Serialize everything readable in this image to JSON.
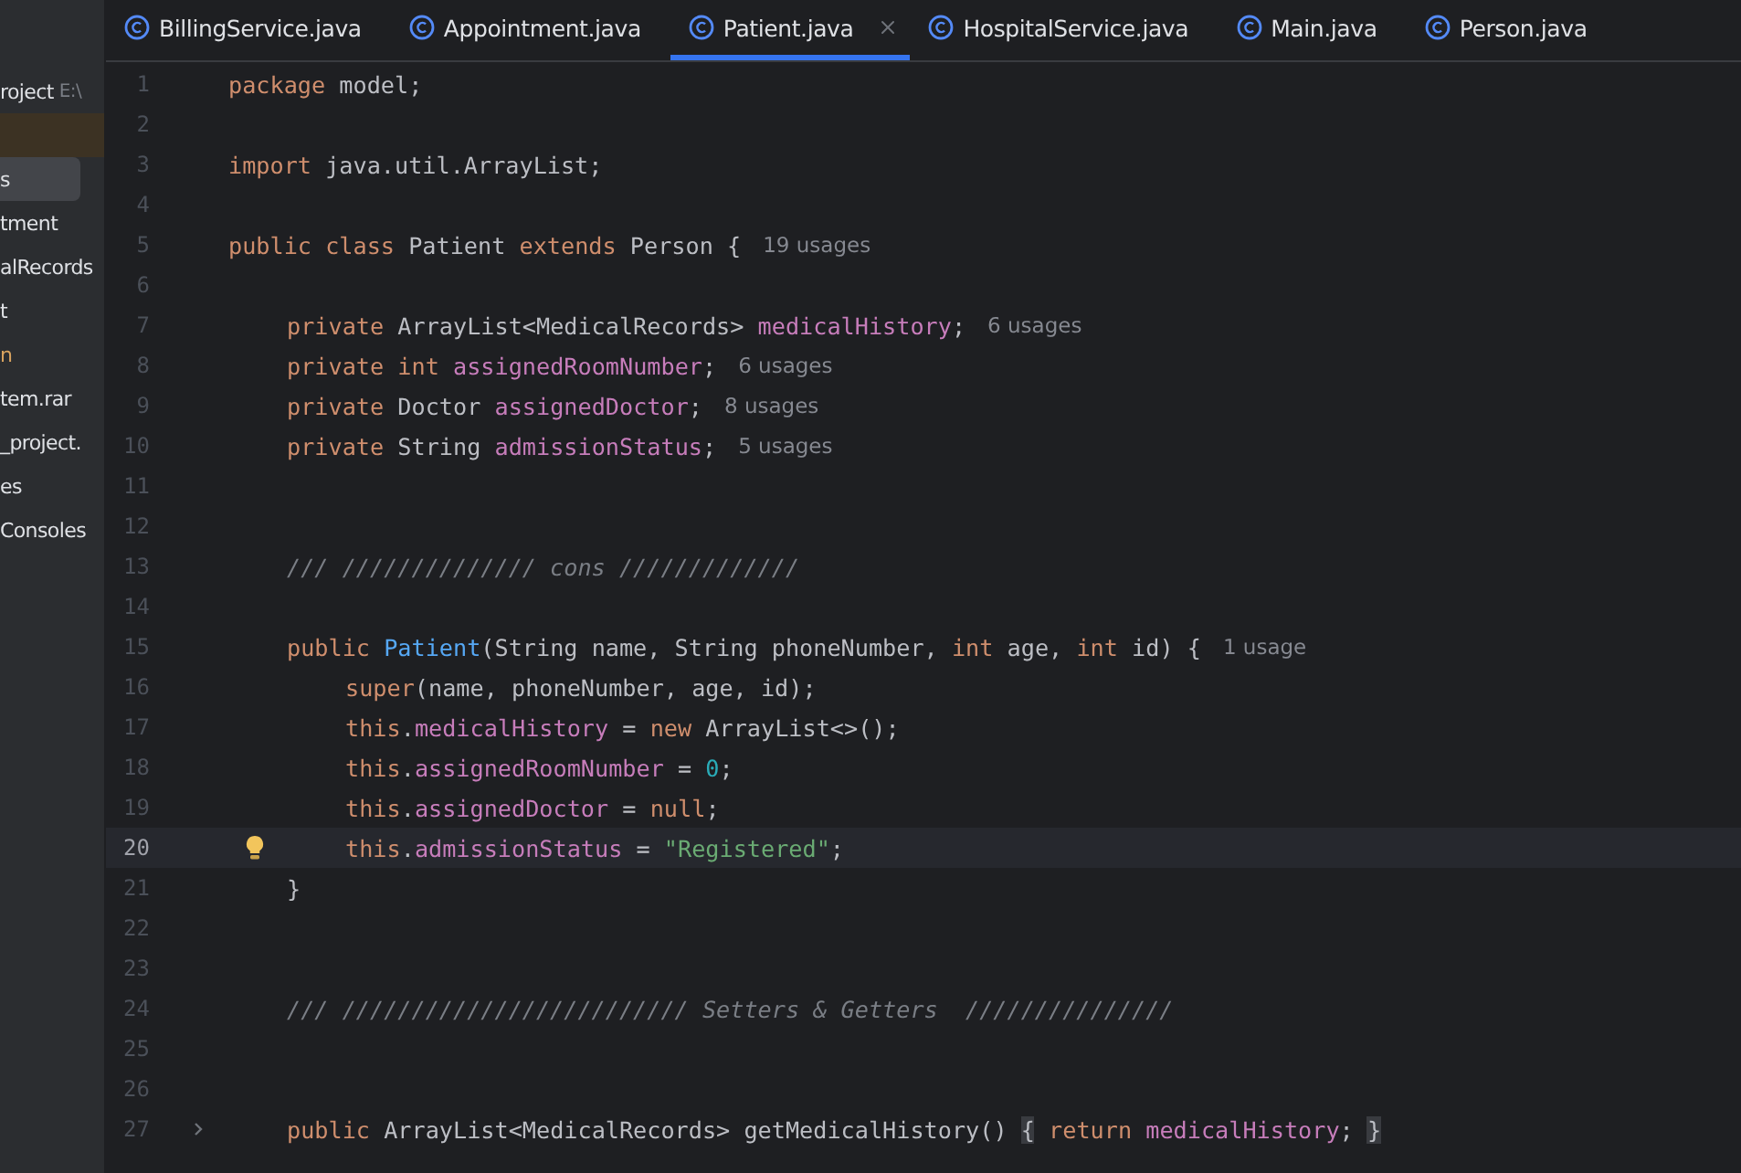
{
  "tabs": [
    {
      "label": "BillingService.java",
      "selected": false
    },
    {
      "label": "Appointment.java",
      "selected": false
    },
    {
      "label": "Patient.java",
      "selected": true
    },
    {
      "label": "HospitalService.java",
      "selected": false
    },
    {
      "label": "Main.java",
      "selected": false
    },
    {
      "label": "Person.java",
      "selected": false
    }
  ],
  "sidebar": {
    "items": [
      {
        "label": "roject",
        "path": "E:\\",
        "selected": false,
        "highlighted": false
      },
      {
        "selected": false,
        "highlighted": true
      },
      {
        "label": "s",
        "selected": true,
        "highlighted": false
      },
      {
        "label": "tment",
        "selected": false,
        "highlighted": false
      },
      {
        "label": "alRecords",
        "selected": false,
        "highlighted": false
      },
      {
        "label": "t",
        "selected": false,
        "highlighted": false
      },
      {
        "label": "n",
        "selected": false,
        "highlighted": false,
        "color": "#d9a35f"
      },
      {
        "label": "tem.rar",
        "selected": false,
        "highlighted": false
      },
      {
        "label": "_project.",
        "selected": false,
        "highlighted": false
      },
      {
        "label": "es",
        "selected": false,
        "highlighted": false
      },
      {
        "label": "Consoles",
        "selected": false,
        "highlighted": false
      }
    ]
  },
  "editor": {
    "lines": [
      {
        "number": "1",
        "tokens": [
          {
            "kind": "kw",
            "text": "package"
          },
          {
            "kind": "plain",
            "text": " model;"
          }
        ]
      },
      {
        "number": "2"
      },
      {
        "number": "3",
        "tokens": [
          {
            "kind": "kw",
            "text": "import"
          },
          {
            "kind": "plain",
            "text": " java.util.ArrayList;"
          }
        ]
      },
      {
        "number": "4"
      },
      {
        "number": "5",
        "tokens": [
          {
            "kind": "kw",
            "text": "public class"
          },
          {
            "kind": "plain",
            "text": " Patient "
          },
          {
            "kind": "kw",
            "text": "extends"
          },
          {
            "kind": "plain",
            "text": " Person {"
          }
        ],
        "hint": "19 usages",
        "children": [
          {
            "number": "6"
          },
          {
            "number": "7",
            "tokens": [
              {
                "kind": "kw",
                "text": "private"
              },
              {
                "kind": "plain",
                "text": " ArrayList<MedicalRecords> "
              },
              {
                "kind": "field",
                "text": "medicalHistory"
              },
              {
                "kind": "plain",
                "text": ";"
              }
            ],
            "hint": "6 usages"
          },
          {
            "number": "8",
            "tokens": [
              {
                "kind": "kw",
                "text": "private int "
              },
              {
                "kind": "field",
                "text": "assignedRoomNumber"
              },
              {
                "kind": "plain",
                "text": ";"
              }
            ],
            "hint": "6 usages"
          },
          {
            "number": "9",
            "tokens": [
              {
                "kind": "kw",
                "text": "private"
              },
              {
                "kind": "plain",
                "text": " Doctor "
              },
              {
                "kind": "field",
                "text": "assignedDoctor"
              },
              {
                "kind": "plain",
                "text": ";"
              }
            ],
            "hint": "8 usages"
          },
          {
            "number": "10",
            "tokens": [
              {
                "kind": "kw",
                "text": "private"
              },
              {
                "kind": "plain",
                "text": " String "
              },
              {
                "kind": "field",
                "text": "admissionStatus"
              },
              {
                "kind": "plain",
                "text": ";"
              }
            ],
            "hint": "5 usages"
          },
          {
            "number": "11"
          },
          {
            "number": "12"
          },
          {
            "number": "13",
            "tokens": [
              {
                "kind": "comment",
                "text": "/// ////////////// cons /////////////"
              }
            ]
          },
          {
            "number": "14"
          },
          {
            "number": "15",
            "tokens": [
              {
                "kind": "kw",
                "text": "public "
              },
              {
                "kind": "method",
                "text": "Patient"
              },
              {
                "kind": "plain",
                "text": "(String name, String phoneNumber, "
              },
              {
                "kind": "kw",
                "text": "int"
              },
              {
                "kind": "plain",
                "text": " age, "
              },
              {
                "kind": "kw",
                "text": "int"
              },
              {
                "kind": "plain",
                "text": " id) {"
              }
            ],
            "hint": "1 usage",
            "children": [
              {
                "number": "16",
                "tokens": [
                  {
                    "kind": "kw",
                    "text": "super"
                  },
                  {
                    "kind": "plain",
                    "text": "(name, phoneNumber, age, id);"
                  }
                ]
              },
              {
                "number": "17",
                "tokens": [
                  {
                    "kind": "kw",
                    "text": "this"
                  },
                  {
                    "kind": "plain",
                    "text": "."
                  },
                  {
                    "kind": "field",
                    "text": "medicalHistory"
                  },
                  {
                    "kind": "plain",
                    "text": " = "
                  },
                  {
                    "kind": "kw",
                    "text": "new"
                  },
                  {
                    "kind": "plain",
                    "text": " ArrayList<>();"
                  }
                ]
              },
              {
                "number": "18",
                "tokens": [
                  {
                    "kind": "kw",
                    "text": "this"
                  },
                  {
                    "kind": "plain",
                    "text": "."
                  },
                  {
                    "kind": "field",
                    "text": "assignedRoomNumber"
                  },
                  {
                    "kind": "plain",
                    "text": " = "
                  },
                  {
                    "kind": "num",
                    "text": "0"
                  },
                  {
                    "kind": "plain",
                    "text": ";"
                  }
                ]
              },
              {
                "number": "19",
                "tokens": [
                  {
                    "kind": "kw",
                    "text": "this"
                  },
                  {
                    "kind": "plain",
                    "text": "."
                  },
                  {
                    "kind": "field",
                    "text": "assignedDoctor"
                  },
                  {
                    "kind": "plain",
                    "text": " = "
                  },
                  {
                    "kind": "kw",
                    "text": "null"
                  },
                  {
                    "kind": "plain",
                    "text": ";"
                  }
                ]
              },
              {
                "number": "20",
                "current": true,
                "bulb": true,
                "tokens": [
                  {
                    "kind": "kw",
                    "text": "this"
                  },
                  {
                    "kind": "plain",
                    "text": "."
                  },
                  {
                    "kind": "field",
                    "text": "admissionStatus"
                  },
                  {
                    "kind": "plain",
                    "text": " = "
                  },
                  {
                    "kind": "str",
                    "text": "\"Registered\""
                  },
                  {
                    "kind": "plain",
                    "text": ";"
                  }
                ]
              }
            ]
          },
          {
            "number": "21",
            "tokens": [
              {
                "kind": "plain",
                "text": "}"
              }
            ]
          },
          {
            "number": "22"
          },
          {
            "number": "23"
          },
          {
            "number": "24",
            "tokens": [
              {
                "kind": "comment",
                "text": "/// ///////////////////////// Setters & Getters  ///////////////"
              }
            ]
          },
          {
            "number": "25"
          },
          {
            "number": "26"
          },
          {
            "number": "27",
            "fold": true,
            "tokens": [
              {
                "kind": "kw",
                "text": "public"
              },
              {
                "kind": "plain",
                "text": " ArrayList<MedicalRecords> getMedicalHistory() "
              },
              {
                "kind": "folded",
                "text": "{"
              },
              {
                "kind": "kw",
                "text": " return "
              },
              {
                "kind": "field",
                "text": "medicalHistory"
              },
              {
                "kind": "plain",
                "text": "; "
              },
              {
                "kind": "folded",
                "text": "}"
              }
            ]
          }
        ]
      }
    ]
  }
}
